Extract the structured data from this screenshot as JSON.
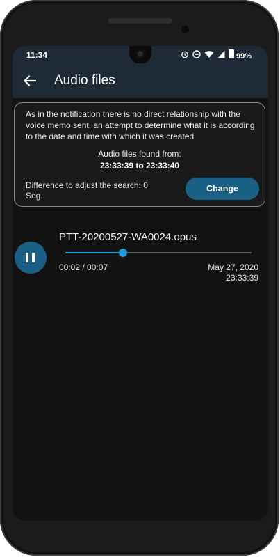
{
  "status_bar": {
    "time": "11:34",
    "battery_text": "99%",
    "icons": [
      "alarm-icon",
      "do-not-disturb-icon",
      "wifi-icon",
      "signal-icon",
      "battery-icon"
    ]
  },
  "app_bar": {
    "title": "Audio files",
    "back_icon": "arrow-left-icon"
  },
  "info_card": {
    "description": "As in the notification there is no direct relationship with the voice memo sent, an attempt to determine what it is according to the date and time with which it was created",
    "found_label": "Audio files found from:",
    "found_range": "23:33:39 to 23:33:40",
    "difference_text": "Difference to adjust the search: 0 Seg.",
    "change_button": "Change"
  },
  "audio_items": [
    {
      "file_name": "PTT-20200527-WA0024.opus",
      "elapsed": "00:02 / 00:07",
      "progress_fraction": 0.31,
      "date": "May 27, 2020",
      "time": "23:33:39",
      "control_icon": "pause-icon"
    }
  ],
  "colors": {
    "accent": "#1a5f84",
    "progress": "#1e9bdc",
    "app_bar_bg": "#1e2a36",
    "background": "#121212"
  }
}
